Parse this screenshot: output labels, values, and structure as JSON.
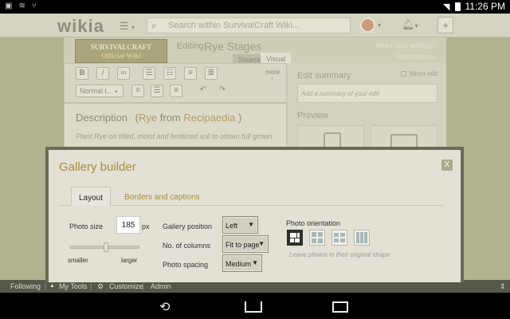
{
  "status_bar": {
    "time": "11:26 PM"
  },
  "topbar": {
    "logo": "wikia",
    "search_placeholder": "Search within SurvivalCraft Wiki..."
  },
  "editor": {
    "banner_line1": "SURVIVALCRAFT",
    "banner_line2": "Official Wiki",
    "editing_label": "Editing",
    "page_title": "Rye Stages",
    "tab_source": "Source",
    "tab_visual": "Visual",
    "need_help": "Need help editing?",
    "notifications": "Notifications",
    "more_label": "more",
    "format_select": "Normal t...",
    "heading_prefix": "Description",
    "heading_link1": "Rye",
    "heading_from": "from",
    "heading_link2": "Recipaedia",
    "heading_close": ")",
    "paragraph": "Plant Rye on tilled, moist and fertilized soil to obtain full grown plants. Harvesting the plants will yield large number of rye seeds. Rye also"
  },
  "sidebar": {
    "edit_summary": "Edit summary",
    "minor_edit": "Minor edit",
    "summary_placeholder": "Add a summary of your edit",
    "preview": "Preview"
  },
  "footer": {
    "following": "Following",
    "my_tools": "My Tools",
    "customize": "Customize",
    "admin": "Admin"
  },
  "modal": {
    "title": "Gallery builder",
    "close": "X",
    "tab_layout": "Layout",
    "tab_borders": "Borders and captions",
    "photo_size_label": "Photo size",
    "photo_size_value": "185",
    "photo_size_unit": "px",
    "slider_smaller": "smaller",
    "slider_larger": "larger",
    "slider_value_fraction": 0.52,
    "gallery_position_label": "Gallery position",
    "gallery_position_value": "Left",
    "columns_label": "No. of columns",
    "columns_value": "Fit to page",
    "spacing_label": "Photo spacing",
    "spacing_value": "Medium",
    "orientation_label": "Photo orientation",
    "orientation_hint": "Leave photos in their original shape"
  }
}
